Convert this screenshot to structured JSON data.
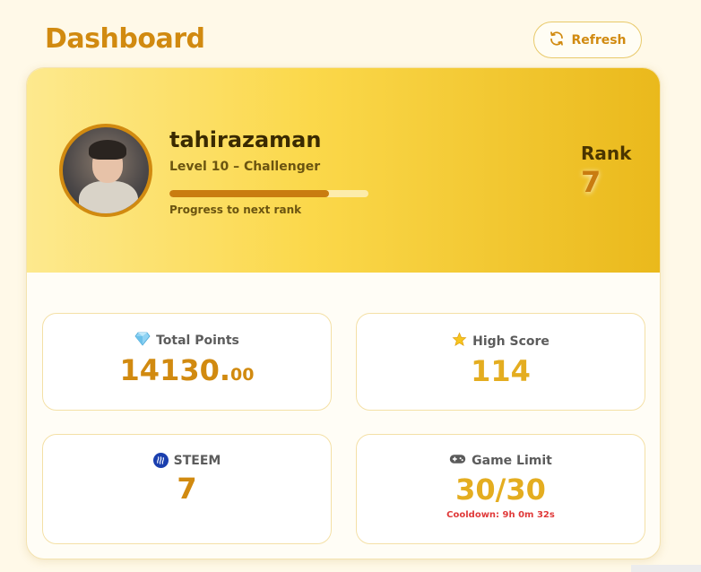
{
  "header": {
    "title": "Dashboard",
    "refresh_label": "Refresh"
  },
  "profile": {
    "username": "tahirazaman",
    "level": "Level 10 – Challenger",
    "progress_label": "Progress to next rank",
    "progress_fraction": 0.8,
    "rank_label": "Rank",
    "rank_value": "7"
  },
  "stats": {
    "total_points": {
      "icon": "gem-icon",
      "label": "Total Points",
      "value": "14130.",
      "decimals": "00"
    },
    "high_score": {
      "icon": "star-icon",
      "label": "High Score",
      "value": "114"
    },
    "steem": {
      "icon": "steem-icon",
      "label": "STEEM",
      "value": "7"
    },
    "game_limit": {
      "icon": "gamepad-icon",
      "label": "Game Limit",
      "value": "30/30",
      "cooldown": "Cooldown: 9h 0m 32s"
    }
  },
  "colors": {
    "accent": "#d18a10",
    "gold": "#e4ad20",
    "warning": "#e03a3a",
    "background": "#fff9e8"
  }
}
